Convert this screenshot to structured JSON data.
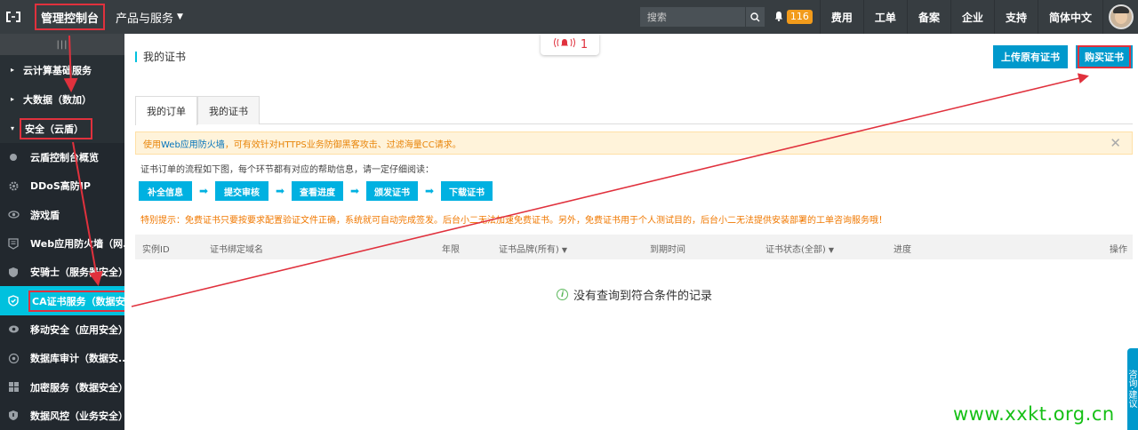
{
  "topbar": {
    "console_label": "管理控制台",
    "products_label": "产品与服务",
    "search_placeholder": "搜索",
    "notification_count": "116",
    "nav": [
      "费用",
      "工单",
      "备案",
      "企业",
      "支持",
      "简体中文"
    ]
  },
  "sidebar": {
    "toggle": "|||",
    "groups": [
      {
        "label": "云计算基础服务",
        "arrow": "▸"
      },
      {
        "label": "大数据（数加）",
        "arrow": "▸"
      },
      {
        "label": "安全（云盾）",
        "arrow": "▾"
      }
    ],
    "items": [
      {
        "label": "云盾控制台概览",
        "icon": "dot-icon"
      },
      {
        "label": "DDoS高防IP",
        "icon": "gear-icon"
      },
      {
        "label": "游戏盾",
        "icon": "eye-icon"
      },
      {
        "label": "Web应用防火墙（网...",
        "icon": "firewall-icon"
      },
      {
        "label": "安骑士（服务器安全）",
        "icon": "shield-icon"
      },
      {
        "label": "CA证书服务（数据安...",
        "icon": "certificate-icon"
      },
      {
        "label": "移动安全（应用安全）",
        "icon": "mobile-icon"
      },
      {
        "label": "数据库审计（数据安...",
        "icon": "database-icon"
      },
      {
        "label": "加密服务（数据安全）",
        "icon": "encrypt-icon"
      },
      {
        "label": "数据风控（业务安全）",
        "icon": "risk-icon"
      }
    ]
  },
  "main": {
    "title": "我的证书",
    "alarm_count": "1",
    "upload_button": "上传原有证书",
    "buy_button": "购买证书",
    "tabs": [
      "我的订单",
      "我的证书"
    ],
    "notice_prefix": "使用",
    "notice_link": "Web应用防火墙",
    "notice_suffix": "，可有效针对HTTPS业务防御黑客攻击、过滤海量CC请求。",
    "flow_desc": "证书订单的流程如下图，每个环节都有对应的帮助信息，请一定仔细阅读：",
    "steps": [
      "补全信息",
      "提交审核",
      "查看进度",
      "颁发证书",
      "下载证书"
    ],
    "tip": "特别提示：免费证书只要按要求配置验证文件正确，系统就可自动完成签发。后台小二无法加速免费证书。另外，免费证书用于个人测试目的，后台小二无法提供安装部署的工单咨询服务哦！",
    "columns": [
      "实例ID",
      "证书绑定域名",
      "年限",
      "证书品牌(所有)",
      "到期时间",
      "证书状态(全部)",
      "进度",
      "操作"
    ],
    "empty_text": "没有查询到符合条件的记录"
  },
  "float_tab": "咨询·建议",
  "watermark": "www.xxkt.org.cn",
  "colors": {
    "topbar": "#373d41",
    "sidebar": "#22282e",
    "accent": "#00c1de",
    "primary_button": "#0099cc",
    "annotation": "#e0313d",
    "watermark": "#16c016"
  }
}
